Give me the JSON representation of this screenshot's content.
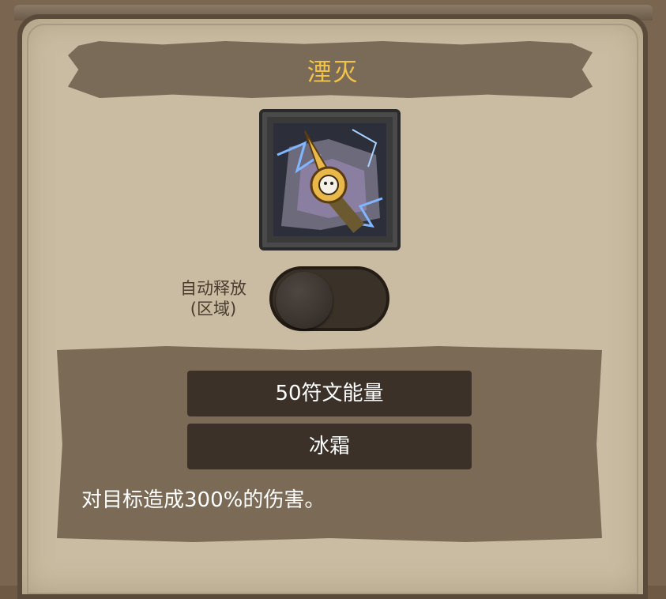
{
  "skill": {
    "title": "湮灭",
    "icon": "annihilation-skill-icon"
  },
  "auto_cast": {
    "label_line1": "自动释放",
    "label_line2": "(区域)",
    "enabled": false
  },
  "info": {
    "energy_tag": "50符文能量",
    "element_tag": "冰霜",
    "description": "对目标造成300%的伤害。"
  },
  "colors": {
    "title": "#f0c24a",
    "parchment": "#c9bca2",
    "panel": "#7b6a56",
    "tag_bg": "#3b3128"
  }
}
